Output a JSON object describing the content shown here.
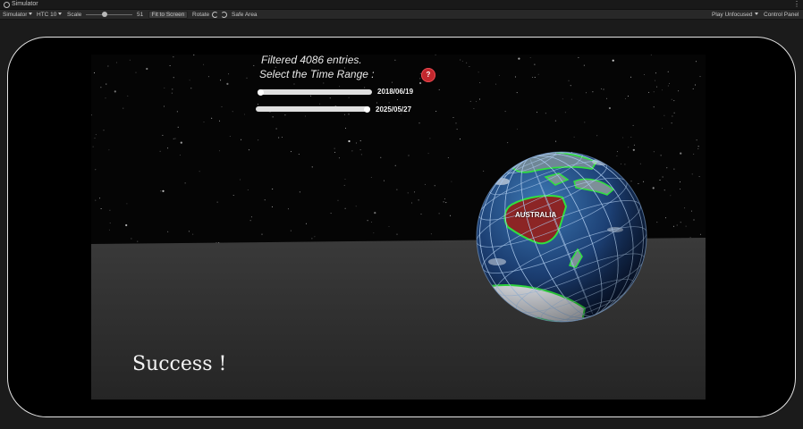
{
  "window": {
    "title": "Simulator"
  },
  "toolbar": {
    "view_select": "Simulator",
    "device_select": "HTC 10",
    "scale_label": "Scale",
    "scale_value": "51",
    "scale_fraction": 0.4,
    "fit_button": "Fit to Screen",
    "rotate_label": "Rotate",
    "safe_area_label": "Safe Area",
    "play_mode_select": "Play Unfocused",
    "control_panel_label": "Control Panel"
  },
  "game": {
    "filter_status": "Filtered 4086 entries.",
    "time_range_prompt": "Select the Time Range :",
    "help_label": "?",
    "start_date": "2018/06/19",
    "end_date": "2025/05/27",
    "globe_region_label": "AUSTRALIA",
    "result_message": "Success !"
  }
}
